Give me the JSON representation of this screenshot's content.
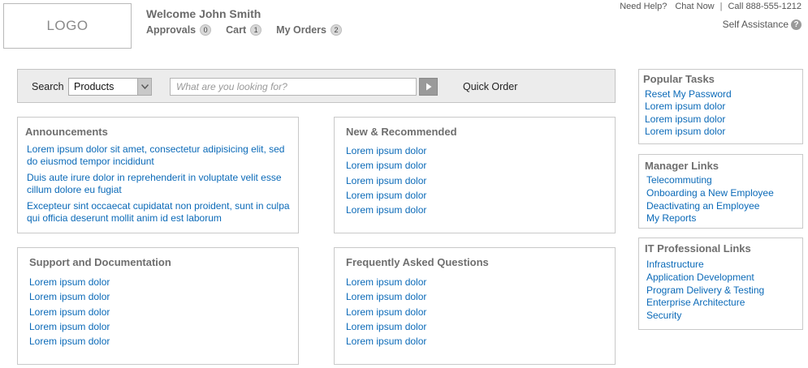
{
  "header": {
    "logo": "LOGO",
    "welcome": "Welcome John Smith",
    "nav": [
      {
        "label": "Approvals",
        "count": "0"
      },
      {
        "label": "Cart",
        "count": "1"
      },
      {
        "label": "My Orders",
        "count": "2"
      }
    ],
    "utility": {
      "need_help": "Need Help?",
      "chat_now": "Chat Now",
      "separator": "|",
      "phone": "Call 888-555-1212"
    },
    "self_assistance": "Self Assistance",
    "help_icon_glyph": "?"
  },
  "search": {
    "label": "Search",
    "category": "Products",
    "placeholder": "What are you looking for?",
    "quick_order": "Quick Order"
  },
  "panels": {
    "announcements": {
      "title": "Announcements",
      "items": [
        "Lorem ipsum dolor sit amet, consectetur adipisicing elit, sed do eiusmod tempor incididunt",
        "Duis aute irure dolor in reprehenderit in voluptate velit esse cillum dolore eu fugiat",
        "Excepteur sint occaecat cupidatat non proident, sunt in culpa qui officia deserunt mollit anim id est laborum"
      ]
    },
    "new_recommended": {
      "title": "New & Recommended",
      "items": [
        "Lorem ipsum dolor",
        "Lorem ipsum dolor",
        "Lorem ipsum dolor",
        "Lorem ipsum dolor",
        "Lorem ipsum dolor"
      ]
    },
    "support": {
      "title": "Support and Documentation",
      "items": [
        "Lorem ipsum dolor",
        "Lorem ipsum dolor",
        "Lorem ipsum dolor",
        "Lorem ipsum dolor",
        "Lorem ipsum dolor"
      ]
    },
    "faq": {
      "title": "Frequently Asked Questions",
      "items": [
        "Lorem ipsum dolor",
        "Lorem ipsum dolor",
        "Lorem ipsum dolor",
        "Lorem ipsum dolor",
        "Lorem ipsum dolor"
      ]
    }
  },
  "sidebar": {
    "popular": {
      "title": "Popular Tasks",
      "items": [
        "Reset My Password",
        "Lorem ipsum dolor",
        "Lorem ipsum dolor",
        "Lorem ipsum dolor"
      ]
    },
    "manager": {
      "title": "Manager Links",
      "items": [
        "Telecommuting",
        "Onboarding a New Employee",
        "Deactivating an Employee",
        "My Reports"
      ]
    },
    "it": {
      "title": "IT Professional Links",
      "items": [
        "Infrastructure",
        "Application Development",
        "Program Delivery & Testing",
        "Enterprise Architecture",
        "Security"
      ]
    }
  },
  "colors": {
    "link": "#0b6ab8",
    "heading": "#6e6e6e",
    "search_bar_bg": "#ececec",
    "border": "#c9c9c9"
  }
}
